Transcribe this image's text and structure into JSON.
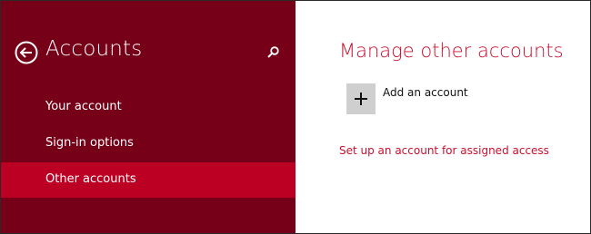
{
  "colors": {
    "sidebar_background": "#760017",
    "selected_item_background": "#bc0024",
    "accent": "#c8102e",
    "add_tile_background": "#cfcfcf"
  },
  "sidebar": {
    "back_icon": "circle-left-arrow-icon",
    "title": "Accounts",
    "search_icon": "search-icon",
    "items": [
      {
        "label": "Your account",
        "selected": false
      },
      {
        "label": "Sign-in options",
        "selected": false
      },
      {
        "label": "Other accounts",
        "selected": true
      }
    ]
  },
  "main": {
    "title": "Manage other accounts",
    "add_account": {
      "icon": "plus-icon",
      "label": "Add an account"
    },
    "assigned_access_link": "Set up an account for assigned access"
  }
}
